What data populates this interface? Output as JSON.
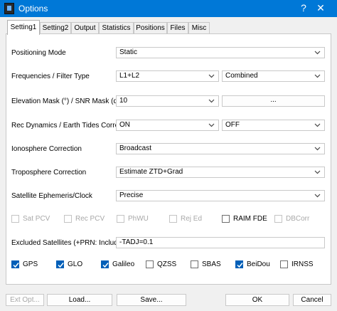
{
  "window": {
    "title": "Options",
    "help_icon": "?",
    "close_icon": "✕"
  },
  "tabs": [
    "Setting1",
    "Setting2",
    "Output",
    "Statistics",
    "Positions",
    "Files",
    "Misc"
  ],
  "active_tab": "Setting1",
  "form": {
    "positioning_mode": {
      "label": "Positioning Mode",
      "value": "Static"
    },
    "frequencies": {
      "label": "Frequencies / Filter Type",
      "value": "L1+L2",
      "filter_value": "Combined"
    },
    "elevation": {
      "label": "Elevation Mask (°) / SNR Mask (dBHz)",
      "value": "10",
      "button": "..."
    },
    "rec_dynamics": {
      "label": "Rec Dynamics / Earth Tides Correction",
      "value": "ON",
      "tides_value": "OFF"
    },
    "ionosphere": {
      "label": "Ionosphere Correction",
      "value": "Broadcast"
    },
    "troposphere": {
      "label": "Troposphere Correction",
      "value": "Estimate ZTD+Grad"
    },
    "ephemeris": {
      "label": "Satellite Ephemeris/Clock",
      "value": "Precise"
    },
    "options": [
      {
        "label": "Sat PCV",
        "checked": false,
        "disabled": true
      },
      {
        "label": "Rec PCV",
        "checked": false,
        "disabled": true
      },
      {
        "label": "PhWU",
        "checked": false,
        "disabled": true
      },
      {
        "label": "Rej Ed",
        "checked": false,
        "disabled": true
      },
      {
        "label": "RAIM FDE",
        "checked": false,
        "disabled": false
      },
      {
        "label": "DBCorr",
        "checked": false,
        "disabled": true
      }
    ],
    "excluded": {
      "label": "Excluded Satellites (+PRN: Included)",
      "value": "-TADJ=0.1"
    },
    "systems": [
      {
        "label": "GPS",
        "checked": true
      },
      {
        "label": "GLO",
        "checked": true
      },
      {
        "label": "Galileo",
        "checked": true
      },
      {
        "label": "QZSS",
        "checked": false
      },
      {
        "label": "SBAS",
        "checked": false
      },
      {
        "label": "BeiDou",
        "checked": true
      },
      {
        "label": "IRNSS",
        "checked": false
      }
    ]
  },
  "footer": {
    "ext_opt": "Ext Opt...",
    "load": "Load...",
    "save": "Save...",
    "ok": "OK",
    "cancel": "Cancel"
  }
}
